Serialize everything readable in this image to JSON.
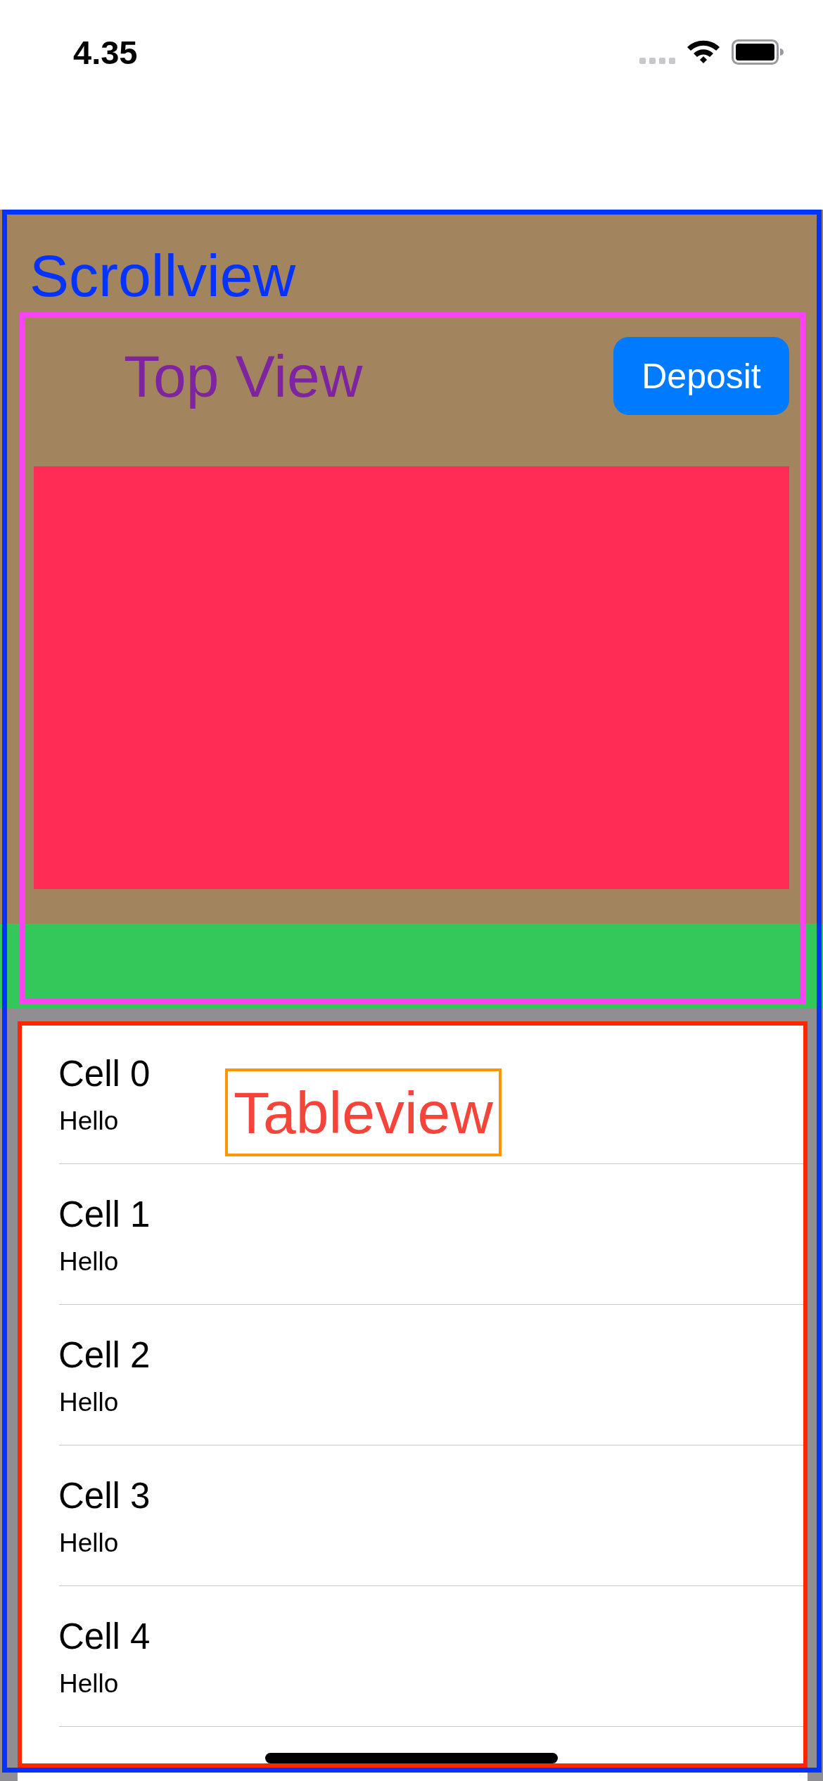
{
  "status_bar": {
    "time": "4.35"
  },
  "scroll_view": {
    "label": "Scrollview"
  },
  "top_view": {
    "label": "Top View",
    "button": "Deposit"
  },
  "table_view": {
    "label": "Tableview",
    "rows": [
      {
        "title": "Cell 0",
        "subtitle": "Hello"
      },
      {
        "title": "Cell 1",
        "subtitle": "Hello"
      },
      {
        "title": "Cell 2",
        "subtitle": "Hello"
      },
      {
        "title": "Cell 3",
        "subtitle": "Hello"
      },
      {
        "title": "Cell 4",
        "subtitle": "Hello"
      }
    ]
  }
}
